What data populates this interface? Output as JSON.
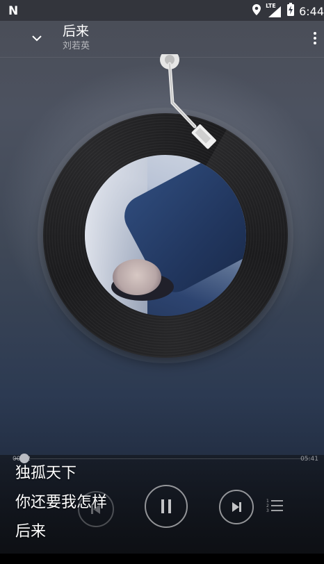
{
  "status_bar": {
    "carrier_glyph": "N",
    "network_label": "LTE",
    "time": "6:44",
    "icons": [
      "location-icon",
      "signal-icon",
      "battery-charging-icon"
    ]
  },
  "header": {
    "title": "后来",
    "artist": "刘若英",
    "icons": [
      "chevron-down-icon",
      "more-vert-icon"
    ]
  },
  "player": {
    "elapsed": "00:12",
    "duration": "05:41",
    "progress_fraction": 0.035,
    "state": "playing",
    "icons": [
      "previous-icon",
      "pause-icon",
      "next-icon",
      "playlist-icon"
    ]
  },
  "lyrics_overlay": {
    "lines": [
      "独孤天下",
      "你还要我怎样",
      "后来"
    ]
  },
  "colors": {
    "background_top": "#4a4d56",
    "background_bottom": "#15171d",
    "vinyl": "#1c1c1e",
    "text": "#ffffff"
  }
}
